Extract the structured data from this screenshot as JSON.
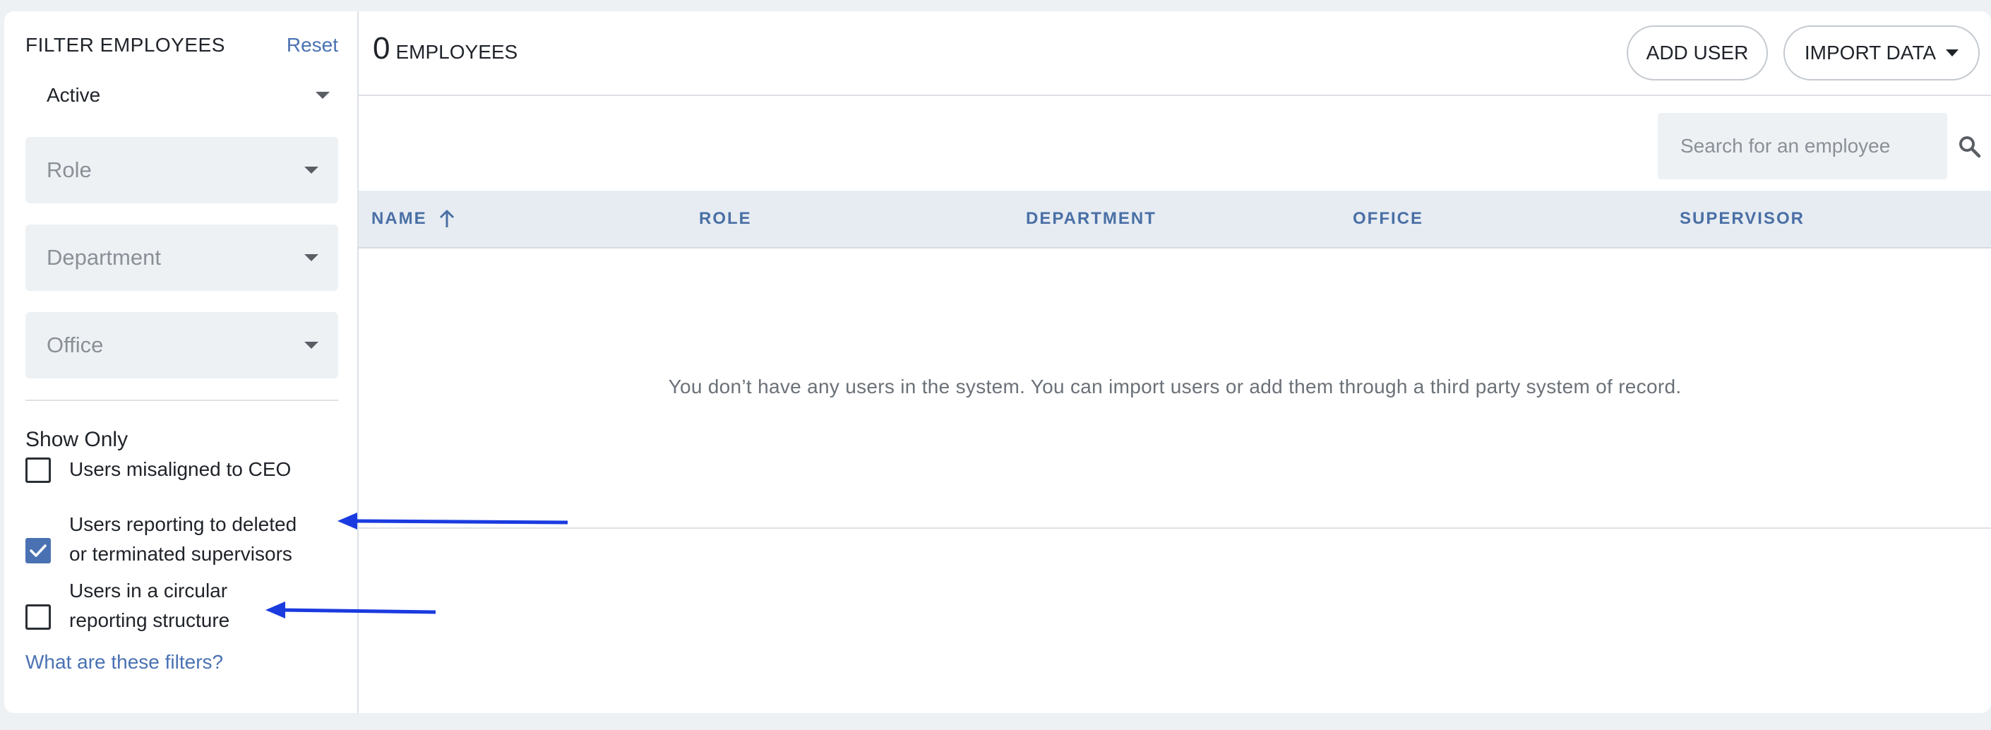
{
  "sidebar": {
    "title": "FILTER EMPLOYEES",
    "reset_label": "Reset",
    "status_value": "Active",
    "filters": {
      "role_placeholder": "Role",
      "department_placeholder": "Department",
      "office_placeholder": "Office"
    },
    "show_only_label": "Show Only",
    "checkboxes": [
      {
        "label": "Users misaligned to CEO",
        "checked": false
      },
      {
        "label": "Users reporting to deleted or terminated supervisors",
        "checked": true
      },
      {
        "label": "Users in a circular reporting structure",
        "checked": false
      }
    ],
    "help_link": "What are these filters?"
  },
  "header": {
    "count_value": "0",
    "count_label": "EMPLOYEES",
    "add_user_label": "ADD USER",
    "import_data_label": "IMPORT DATA"
  },
  "search": {
    "placeholder": "Search for an employee"
  },
  "table": {
    "columns": [
      "NAME",
      "ROLE",
      "DEPARTMENT",
      "OFFICE",
      "SUPERVISOR"
    ],
    "sort": {
      "column": "NAME",
      "direction": "ascending"
    },
    "empty_message": "You don’t have any users in the system. You can import users or add them through a third party system of record."
  },
  "colors": {
    "accent": "#4a72b2",
    "header_text": "#4a6fa5",
    "annotation_arrow": "#1a3be0"
  }
}
